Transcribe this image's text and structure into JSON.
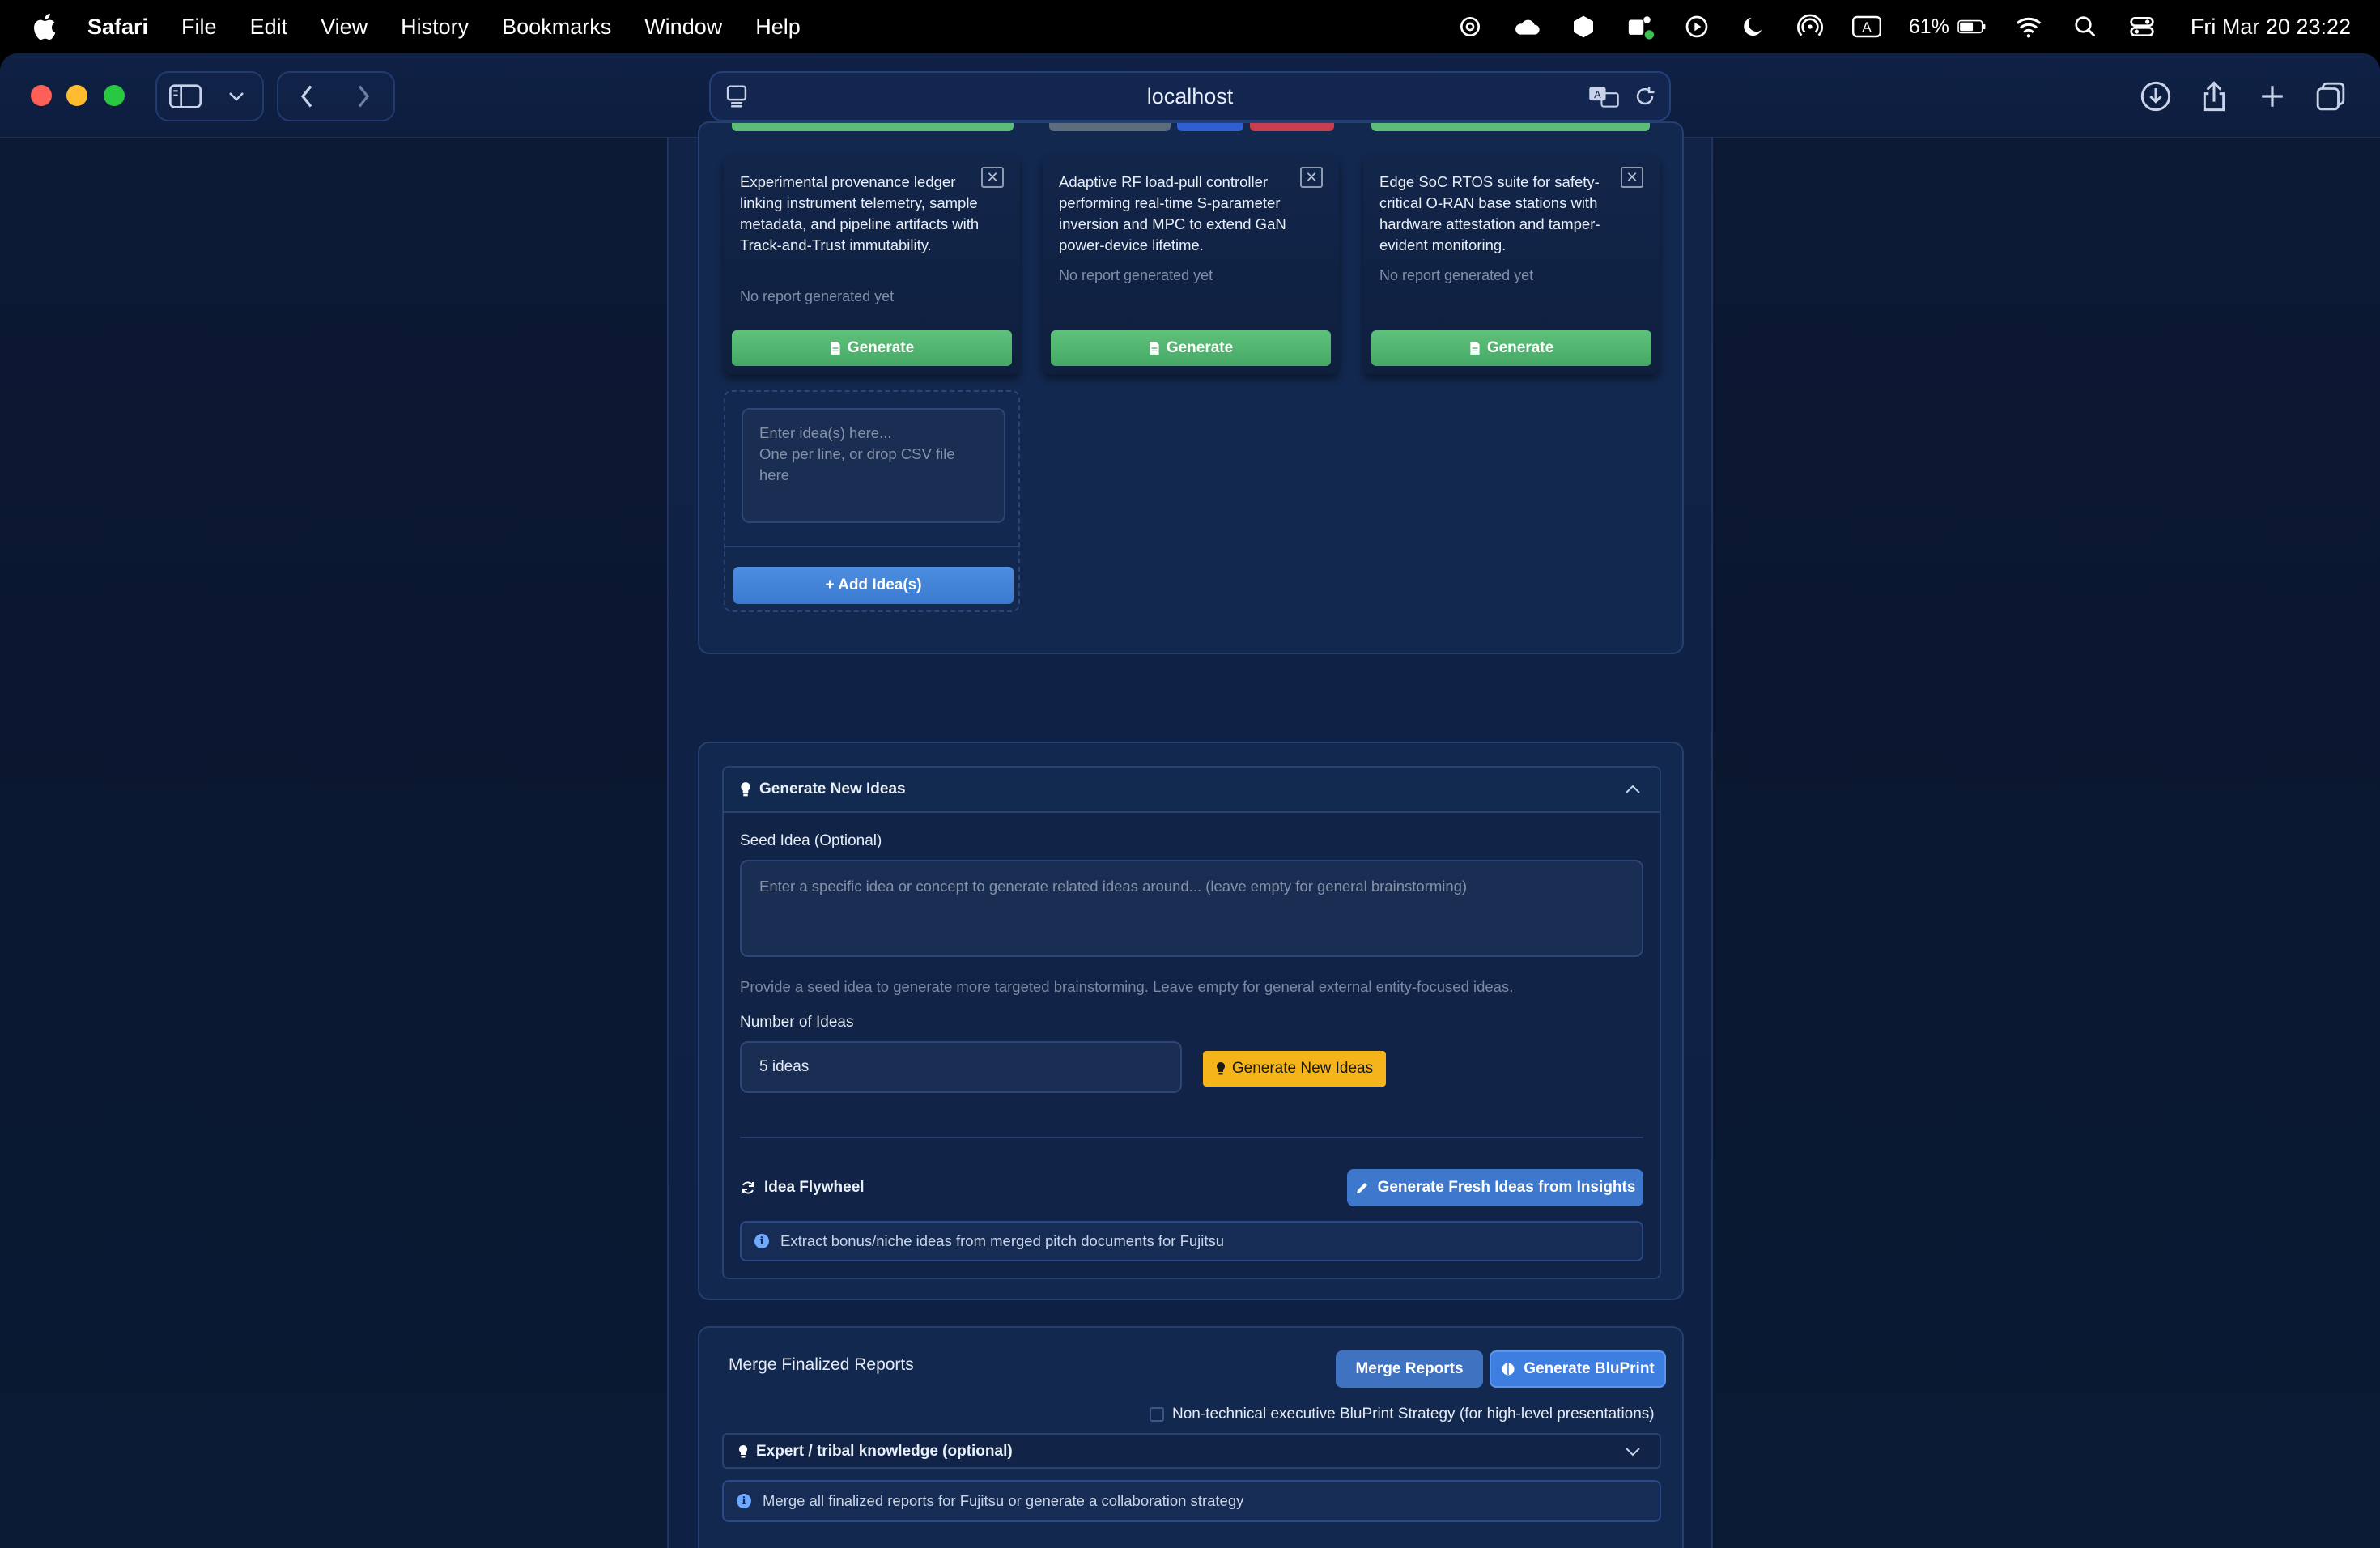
{
  "menubar": {
    "app_name": "Safari",
    "items": [
      "File",
      "Edit",
      "View",
      "History",
      "Bookmarks",
      "Window",
      "Help"
    ],
    "battery": "61%",
    "clock": "Fri Mar 20  23:22"
  },
  "browser": {
    "address": "localhost"
  },
  "idea_cards": [
    {
      "description": "Experimental provenance ledger linking instrument telemetry, sample metadata, and pipeline artifacts with Track-and-Trust immutability.",
      "status": "No report generated yet",
      "generate_label": "Generate"
    },
    {
      "description": "Adaptive RF load-pull controller performing real-time S-parameter inversion and MPC to extend GaN power-device lifetime.",
      "status": "No report generated yet",
      "generate_label": "Generate"
    },
    {
      "description": "Edge SoC RTOS suite for safety-critical O-RAN base stations with hardware attestation and tamper-evident monitoring.",
      "status": "No report generated yet",
      "generate_label": "Generate"
    }
  ],
  "add_ideas": {
    "placeholder": "Enter idea(s) here...\nOne per line, or drop CSV file here",
    "button_label": "+ Add Idea(s)"
  },
  "generate_new_ideas": {
    "header": "Generate New Ideas",
    "seed_label": "Seed Idea (Optional)",
    "seed_placeholder": "Enter a specific idea or concept to generate related ideas around... (leave empty for general brainstorming)",
    "seed_help": "Provide a seed idea to generate more targeted brainstorming. Leave empty for general external entity-focused ideas.",
    "count_label": "Number of Ideas",
    "count_value": "5 ideas",
    "button_label": "Generate New Ideas"
  },
  "flywheel": {
    "title": "Idea Flywheel",
    "button_label": "Generate Fresh Ideas from Insights",
    "info": "Extract bonus/niche ideas from merged pitch documents for Fujitsu"
  },
  "merge": {
    "title": "Merge Finalized Reports",
    "merge_button": "Merge Reports",
    "bluprint_button": "Generate BluPrint",
    "checkbox_label": "Non-technical executive BluPrint Strategy (for high-level presentations)",
    "expert_label": "Expert / tribal knowledge (optional)",
    "info": "Merge all finalized reports for Fujitsu or generate a collaboration strategy"
  }
}
